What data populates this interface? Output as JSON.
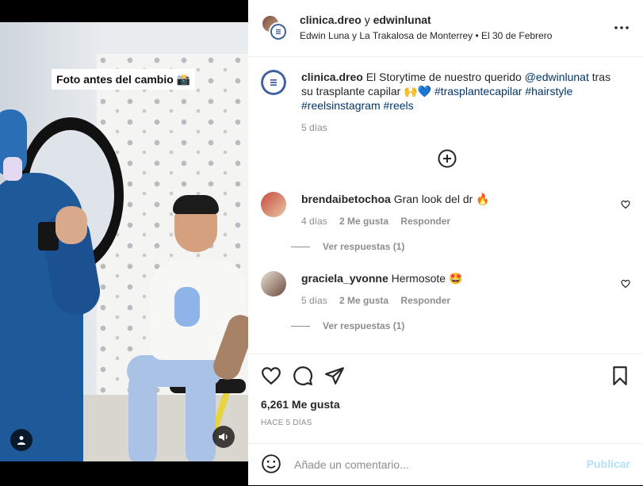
{
  "media": {
    "overlay_caption": "Foto antes del cambio 📸",
    "icons": {
      "user_tag": "user-icon",
      "mute": "speaker-icon"
    }
  },
  "header": {
    "user1": "clinica.dreo",
    "connector": " y ",
    "user2": "edwinlunat",
    "subtitle": "Edwin Luna y La Trakalosa de Monterrey • El 30 de Febrero",
    "more_icon": "more-horizontal-icon"
  },
  "caption": {
    "username": "clinica.dreo",
    "text": "El Storytime de nuestro querido ",
    "mention": "@edwinlunat",
    "text2": " tras su trasplante capilar 🙌💙 ",
    "hashtags": "#trasplantecapilar #hairstyle #reelsinstagram #reels",
    "time": "5 días"
  },
  "load_more_icon": "plus-circle-icon",
  "comments": [
    {
      "username": "brendaibetochoa",
      "text": "Gran look del dr 🔥",
      "time": "4 días",
      "likes": "2 Me gusta",
      "reply": "Responder",
      "view_replies": "Ver respuestas (1)"
    },
    {
      "username": "graciela_yvonne",
      "text": "Hermosote 🤩",
      "time": "5 días",
      "likes": "2 Me gusta",
      "reply": "Responder",
      "view_replies": "Ver respuestas (1)"
    }
  ],
  "actions": {
    "like_icon": "heart-icon",
    "comment_icon": "comment-icon",
    "share_icon": "send-icon",
    "save_icon": "bookmark-icon",
    "likes": "6,261 Me gusta",
    "posted_ago": "HACE 5 DÍAS"
  },
  "add_comment": {
    "placeholder": "Añade un comentario...",
    "post_label": "Publicar",
    "emoji_icon": "smile-icon"
  },
  "colors": {
    "link": "#00376b",
    "secondary_text": "#8e8e8e",
    "publish_disabled": "#b2dffc",
    "divider": "#efefef"
  }
}
